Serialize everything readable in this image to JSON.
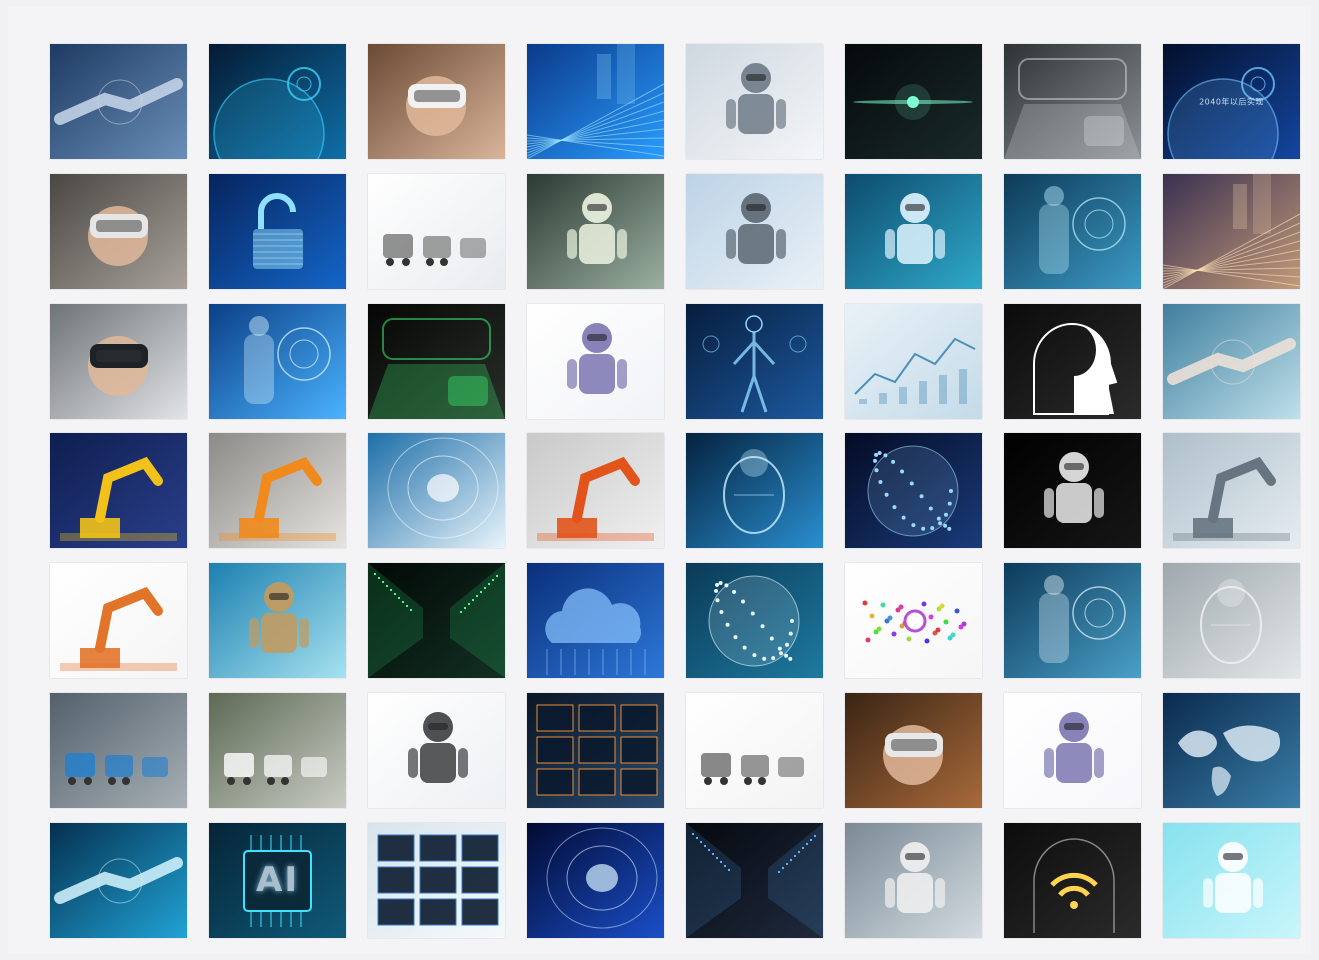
{
  "collage": {
    "rows": 7,
    "columns": 8,
    "tiles": [
      {
        "name": "handshake-tile",
        "bg": [
          "#1d3a62",
          "#6a8fb8"
        ],
        "accent": "#c9d8ea",
        "motif": "handshake"
      },
      {
        "name": "globe-hud-tile",
        "bg": [
          "#041a33",
          "#0f6fa8"
        ],
        "accent": "#39d5ff",
        "motif": "globe"
      },
      {
        "name": "vr-headset-woman-tile",
        "bg": [
          "#6b4a34",
          "#d9b59a"
        ],
        "accent": "#f2f2f2",
        "motif": "vr"
      },
      {
        "name": "digital-city-tile",
        "bg": [
          "#0a3a8a",
          "#2a9cff"
        ],
        "accent": "#9fe6ff",
        "motif": "rays"
      },
      {
        "name": "lab-robot-tile",
        "bg": [
          "#cfd8e0",
          "#f4f6f8"
        ],
        "accent": "#6d7a86",
        "motif": "robot"
      },
      {
        "name": "space-flare-tile",
        "bg": [
          "#05090c",
          "#1a2a2a"
        ],
        "accent": "#7dffd0",
        "motif": "flare"
      },
      {
        "name": "car-interior-tile",
        "bg": [
          "#2e3235",
          "#8b9196"
        ],
        "accent": "#d9dcde",
        "motif": "interior"
      },
      {
        "name": "earth-night-tile",
        "bg": [
          "#020f2b",
          "#1446a0"
        ],
        "accent": "#6fc1ff",
        "motif": "globe",
        "caption": "2040年以后实现"
      },
      {
        "name": "vr-user-tile",
        "bg": [
          "#4a4642",
          "#a8a29b"
        ],
        "accent": "#e6e6e6",
        "motif": "vr"
      },
      {
        "name": "digital-lock-tile",
        "bg": [
          "#06245e",
          "#1466c8"
        ],
        "accent": "#8fe0ff",
        "motif": "lock"
      },
      {
        "name": "delivery-robots-tile",
        "bg": [
          "#ffffff",
          "#e9ecef"
        ],
        "accent": "#777777",
        "motif": "robots-small"
      },
      {
        "name": "surgical-robot-tile",
        "bg": [
          "#2b3a33",
          "#9bb0a1"
        ],
        "accent": "#ecf3e0",
        "motif": "robot"
      },
      {
        "name": "white-robot-tile",
        "bg": [
          "#bdd3e6",
          "#e9f1f7"
        ],
        "accent": "#5a6670",
        "motif": "robot"
      },
      {
        "name": "android-hud-tile",
        "bg": [
          "#0c4b6e",
          "#30a9c9"
        ],
        "accent": "#e0f4ff",
        "motif": "robot"
      },
      {
        "name": "hologram-man-tile",
        "bg": [
          "#0d3a57",
          "#3c9bc6"
        ],
        "accent": "#bff0ff",
        "motif": "hud"
      },
      {
        "name": "city-traffic-tile",
        "bg": [
          "#3a3050",
          "#c39a7a"
        ],
        "accent": "#ffe2b5",
        "motif": "rays"
      },
      {
        "name": "vr-pointing-tile",
        "bg": [
          "#6e7378",
          "#e2e4e6"
        ],
        "accent": "#1c2226",
        "motif": "vr"
      },
      {
        "name": "robot-arm-blue-tile",
        "bg": [
          "#0a3f86",
          "#4bb3ff"
        ],
        "accent": "#dff6ff",
        "motif": "hud"
      },
      {
        "name": "self-driving-hud-tile",
        "bg": [
          "#050605",
          "#2a2f2a"
        ],
        "accent": "#3cff78",
        "motif": "interior"
      },
      {
        "name": "toy-robot-tile",
        "bg": [
          "#ffffff",
          "#f2f3f7"
        ],
        "accent": "#7a76b0",
        "motif": "robot"
      },
      {
        "name": "hologram-body-tile",
        "bg": [
          "#061d3d",
          "#1d5aa0"
        ],
        "accent": "#8fd7ff",
        "motif": "body"
      },
      {
        "name": "data-chart-tile",
        "bg": [
          "#e9f1f7",
          "#c4dbe9"
        ],
        "accent": "#4d8fba",
        "motif": "chart"
      },
      {
        "name": "brain-profile-tile",
        "bg": [
          "#0b0b0b",
          "#2b2b2b"
        ],
        "accent": "#ffffff",
        "motif": "profile"
      },
      {
        "name": "robot-human-hands-tile",
        "bg": [
          "#3f7f9e",
          "#bfe0ea"
        ],
        "accent": "#f2e3d8",
        "motif": "handshake"
      },
      {
        "name": "yellow-robot-arm-tile",
        "bg": [
          "#0e1e4f",
          "#2a3f8c"
        ],
        "accent": "#f2c21a",
        "motif": "arm"
      },
      {
        "name": "orange-robot-arm-tile",
        "bg": [
          "#8c8a86",
          "#e6e4e0"
        ],
        "accent": "#f08a1c",
        "motif": "arm"
      },
      {
        "name": "data-tunnel-tile",
        "bg": [
          "#1d6ea8",
          "#e8f4fb"
        ],
        "accent": "#ffffff",
        "motif": "tunnel"
      },
      {
        "name": "welding-robot-tile",
        "bg": [
          "#c9c9c9",
          "#f0f0f0"
        ],
        "accent": "#e2541c",
        "motif": "arm"
      },
      {
        "name": "digital-head-tile",
        "bg": [
          "#04223f",
          "#2a8fd0"
        ],
        "accent": "#c8f0ff",
        "motif": "head"
      },
      {
        "name": "neural-sphere-tile",
        "bg": [
          "#040b24",
          "#1a3b7a"
        ],
        "accent": "#9ad8ff",
        "motif": "sphere"
      },
      {
        "name": "violin-robot-tile",
        "bg": [
          "#000000",
          "#161616"
        ],
        "accent": "#ececec",
        "motif": "robot"
      },
      {
        "name": "robot-hand-keyboard-tile",
        "bg": [
          "#aebfca",
          "#e6edf2"
        ],
        "accent": "#66757f",
        "motif": "arm"
      },
      {
        "name": "factory-arm-tile",
        "bg": [
          "#ffffff",
          "#f5f5f5"
        ],
        "accent": "#e2742a",
        "motif": "arm"
      },
      {
        "name": "wall-e-tile",
        "bg": [
          "#1c80b0",
          "#a6e2f0"
        ],
        "accent": "#c69a5a",
        "motif": "robot"
      },
      {
        "name": "server-corridor-tile",
        "bg": [
          "#020806",
          "#123022"
        ],
        "accent": "#38ff8a",
        "motif": "corridor"
      },
      {
        "name": "cloud-circuit-tile",
        "bg": [
          "#0a2f7a",
          "#2d78d9"
        ],
        "accent": "#8ac4ff",
        "motif": "cloud"
      },
      {
        "name": "particle-sphere-tile",
        "bg": [
          "#0a3a57",
          "#1e7aa0"
        ],
        "accent": "#e8fbff",
        "motif": "sphere"
      },
      {
        "name": "color-network-tile",
        "bg": [
          "#ffffff",
          "#f6f6f6"
        ],
        "accent": "#b84fd6",
        "motif": "network"
      },
      {
        "name": "touchscreen-man-tile",
        "bg": [
          "#0c3a5a",
          "#4aa0c8"
        ],
        "accent": "#e6f4fb",
        "motif": "hud"
      },
      {
        "name": "android-face-tile",
        "bg": [
          "#9ea8ad",
          "#e4e7e9"
        ],
        "accent": "#f2f2f2",
        "motif": "head"
      },
      {
        "name": "warehouse-robots-tile",
        "bg": [
          "#53606b",
          "#a7b0b6"
        ],
        "accent": "#1f7fd0",
        "motif": "robots-small"
      },
      {
        "name": "delivery-van-tile",
        "bg": [
          "#5c6a55",
          "#c9ccc4"
        ],
        "accent": "#ffffff",
        "motif": "robots-small"
      },
      {
        "name": "painting-robot-tile",
        "bg": [
          "#ffffff",
          "#eef0f3"
        ],
        "accent": "#3b3d40",
        "motif": "robot"
      },
      {
        "name": "monitor-wall-tile",
        "bg": [
          "#0a1626",
          "#2a4a6e"
        ],
        "accent": "#ff9a3c",
        "motif": "monitors"
      },
      {
        "name": "robot-call-center-tile",
        "bg": [
          "#ffffff",
          "#f3f3f3"
        ],
        "accent": "#6b6b6b",
        "motif": "robots-small"
      },
      {
        "name": "vr-audience-tile",
        "bg": [
          "#3a2414",
          "#a86a3a"
        ],
        "accent": "#e8e8e8",
        "motif": "vr"
      },
      {
        "name": "small-toy-robot-tile",
        "bg": [
          "#ffffff",
          "#f7f7fb"
        ],
        "accent": "#7a76b0",
        "motif": "robot"
      },
      {
        "name": "world-map-tile",
        "bg": [
          "#0a2a4e",
          "#3a7ea8"
        ],
        "accent": "#e6f2fb",
        "motif": "map"
      },
      {
        "name": "touching-hands-tile",
        "bg": [
          "#04304f",
          "#21a3d6"
        ],
        "accent": "#d6f6ff",
        "motif": "handshake"
      },
      {
        "name": "ai-chip-tile",
        "bg": [
          "#052436",
          "#0f5b7a"
        ],
        "accent": "#3fe1ff",
        "motif": "chip",
        "caption": "AI"
      },
      {
        "name": "tablet-devices-tile",
        "bg": [
          "#d8e4ec",
          "#f6f9fb"
        ],
        "accent": "#1e6fbf",
        "motif": "monitors"
      },
      {
        "name": "light-tunnel-tile",
        "bg": [
          "#020a33",
          "#1a4fc9"
        ],
        "accent": "#d8f4ff",
        "motif": "tunnel"
      },
      {
        "name": "data-center-person-tile",
        "bg": [
          "#05080f",
          "#1f2a3d"
        ],
        "accent": "#5ab0ff",
        "motif": "corridor"
      },
      {
        "name": "robot-thinking-tile",
        "bg": [
          "#7a8a96",
          "#d3dbe0"
        ],
        "accent": "#f1f1f1",
        "motif": "robot"
      },
      {
        "name": "wifi-brain-tile",
        "bg": [
          "#0c0c0c",
          "#2b2b2b"
        ],
        "accent": "#ffd451",
        "motif": "wifi"
      },
      {
        "name": "reclining-robot-tile",
        "bg": [
          "#86e2ee",
          "#c9f6fb"
        ],
        "accent": "#ffffff",
        "motif": "robot"
      }
    ]
  }
}
